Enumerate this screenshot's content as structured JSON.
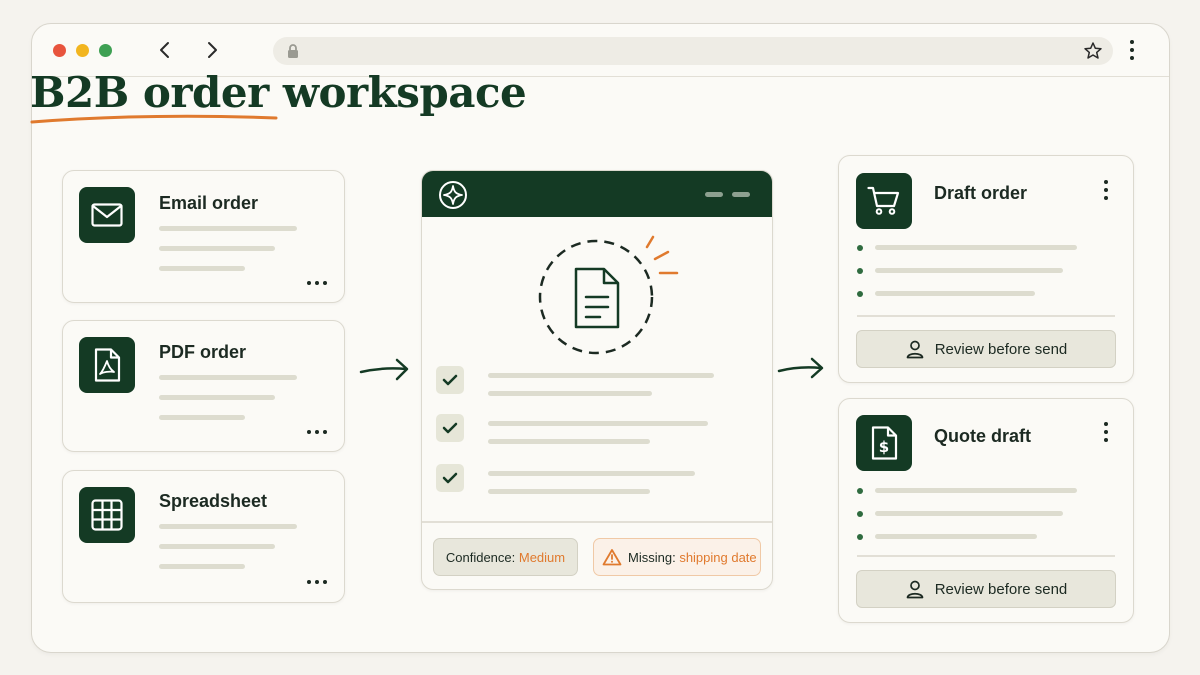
{
  "page": {
    "title": "B2B order workspace"
  },
  "sources": [
    {
      "label": "Email order",
      "icon": "mail-icon"
    },
    {
      "label": "PDF order",
      "icon": "pdf-icon"
    },
    {
      "label": "Spreadsheet",
      "icon": "table-icon"
    }
  ],
  "processor": {
    "icon": "ai-sparkle-icon",
    "document_icon": "document-icon",
    "confidence_label": "Confidence:",
    "confidence_value": "Medium",
    "missing_label": "Missing:",
    "missing_value": "shipping date"
  },
  "outputs": [
    {
      "label": "Draft order",
      "icon": "cart-icon",
      "button_label": "Review before send"
    },
    {
      "label": "Quote draft",
      "icon": "quote-document-icon",
      "button_label": "Review before send"
    }
  ],
  "colors": {
    "brand_dark": "#143a24",
    "accent_orange": "#e07a2e",
    "page_background": "#f5f3ee"
  }
}
